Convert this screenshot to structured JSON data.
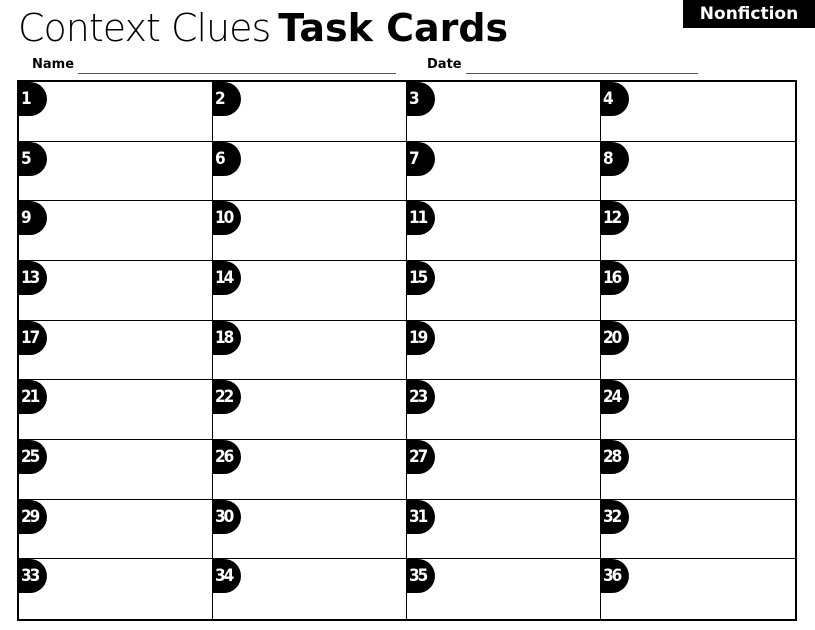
{
  "header": {
    "title_light": "Context Clues",
    "title_bold": "Task Cards",
    "badge": "Nonfiction",
    "name_label": "Name",
    "date_label": "Date"
  },
  "cards": [
    "1",
    "2",
    "3",
    "4",
    "5",
    "6",
    "7",
    "8",
    "9",
    "10",
    "11",
    "12",
    "13",
    "14",
    "15",
    "16",
    "17",
    "18",
    "19",
    "20",
    "21",
    "22",
    "23",
    "24",
    "25",
    "26",
    "27",
    "28",
    "29",
    "30",
    "31",
    "32",
    "33",
    "34",
    "35",
    "36"
  ]
}
